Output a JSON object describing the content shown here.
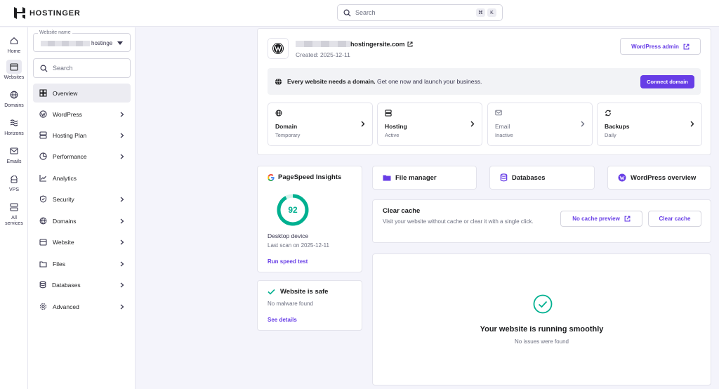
{
  "brand": {
    "name": "HOSTINGER"
  },
  "top_search": {
    "placeholder": "Search",
    "shortcut_keys": [
      "⌘",
      "K"
    ]
  },
  "rail": [
    {
      "label": "Home",
      "icon": "home-icon"
    },
    {
      "label": "Websites",
      "icon": "websites-icon",
      "active": true
    },
    {
      "label": "Domains",
      "icon": "globe-icon"
    },
    {
      "label": "Horizons",
      "icon": "horizons-icon"
    },
    {
      "label": "Emails",
      "icon": "mail-icon"
    },
    {
      "label": "VPS",
      "icon": "cloud-server-icon"
    },
    {
      "label": "All services",
      "icon": "services-icon"
    }
  ],
  "sidebar": {
    "website_select": {
      "label": "Website name",
      "value": "hostinge"
    },
    "search_placeholder": "Search",
    "items": [
      {
        "label": "Overview",
        "icon": "overview-icon",
        "active": true
      },
      {
        "label": "WordPress",
        "icon": "wordpress-icon",
        "chevron": true
      },
      {
        "label": "Hosting Plan",
        "icon": "server-icon",
        "chevron": true
      },
      {
        "label": "Performance",
        "icon": "gauge-icon",
        "chevron": true
      },
      {
        "label": "Analytics",
        "icon": "analytics-icon",
        "chevron": false
      },
      {
        "label": "Security",
        "icon": "shield-icon",
        "chevron": true
      },
      {
        "label": "Domains",
        "icon": "globe-icon",
        "chevron": true
      },
      {
        "label": "Website",
        "icon": "browser-icon",
        "chevron": true
      },
      {
        "label": "Files",
        "icon": "folder-icon",
        "chevron": true
      },
      {
        "label": "Databases",
        "icon": "database-icon",
        "chevron": true
      },
      {
        "label": "Advanced",
        "icon": "gear-icon",
        "chevron": true
      }
    ]
  },
  "site_card": {
    "domain_suffix": "hostingersite.com",
    "created": "Created: 2025-12-11",
    "wp_admin_label": "WordPress admin",
    "banner": {
      "bold": "Every website needs a domain.",
      "text": " Get one now and launch your business.",
      "button": "Connect domain"
    },
    "tiles": [
      {
        "title": "Domain",
        "status": "Temporary",
        "icon": "globe-icon"
      },
      {
        "title": "Hosting",
        "status": "Active",
        "icon": "server-icon"
      },
      {
        "title": "Email",
        "status": "Inactive",
        "icon": "mail-icon"
      },
      {
        "title": "Backups",
        "status": "Daily",
        "icon": "backup-icon"
      }
    ]
  },
  "pagespeed": {
    "title": "PageSpeed Insights",
    "score": 92,
    "device": "Desktop device",
    "last_scan": "Last scan on 2025-12-11",
    "link": "Run speed test",
    "color": "#00b090"
  },
  "safety": {
    "title": "Website is safe",
    "subtitle": "No malware found",
    "link": "See details"
  },
  "quick_links": [
    {
      "label": "File manager",
      "icon": "folder-icon"
    },
    {
      "label": "Databases",
      "icon": "database-icon"
    },
    {
      "label": "WordPress overview",
      "icon": "wordpress-icon"
    }
  ],
  "clear_cache": {
    "title": "Clear cache",
    "description": "Visit your website without cache or clear it with a single click.",
    "preview_button": "No cache preview",
    "clear_button": "Clear cache"
  },
  "status_panel": {
    "title": "Your website is running smoothly",
    "subtitle": "No issues were found"
  },
  "colors": {
    "accent": "#673de6",
    "text": "#1d1e20",
    "muted": "#6d7081",
    "success": "#00b090"
  }
}
